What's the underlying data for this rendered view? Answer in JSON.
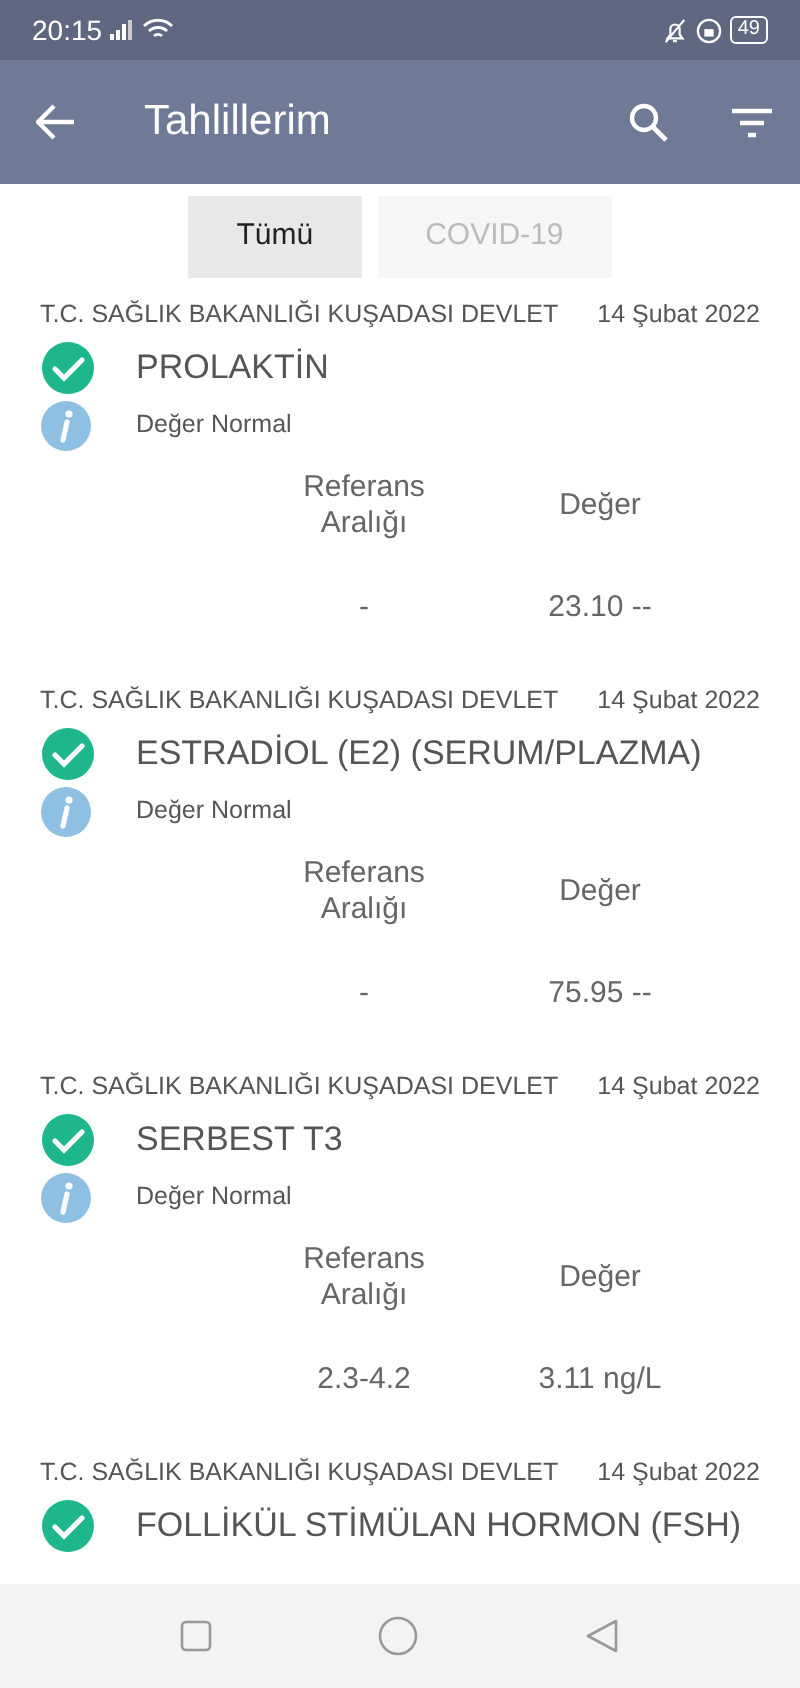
{
  "status_bar": {
    "time": "20:15",
    "battery": "49"
  },
  "app_bar": {
    "title": "Tahlillerim"
  },
  "tabs": [
    {
      "label": "Tümü",
      "selected": true
    },
    {
      "label": "COVID-19",
      "selected": false
    }
  ],
  "results": [
    {
      "hospital": "T.C. SAĞLIK BAKANLIĞI KUŞADASI DEVLET",
      "date": "14 Şubat 2022",
      "test": "PROLAKTİN",
      "note": "Değer Normal",
      "range_header": "Referans Aralığı",
      "value_header": "Değer",
      "range": "-",
      "value": "23.10 --"
    },
    {
      "hospital": "T.C. SAĞLIK BAKANLIĞI KUŞADASI DEVLET",
      "date": "14 Şubat 2022",
      "test": "ESTRADİOL (E2) (SERUM/PLAZMA)",
      "note": "Değer Normal",
      "range_header": "Referans Aralığı",
      "value_header": "Değer",
      "range": "-",
      "value": "75.95 --"
    },
    {
      "hospital": "T.C. SAĞLIK BAKANLIĞI KUŞADASI DEVLET",
      "date": "14 Şubat 2022",
      "test": "SERBEST T3",
      "note": "Değer Normal",
      "range_header": "Referans Aralığı",
      "value_header": "Değer",
      "range": "2.3-4.2",
      "value": "3.11 ng/L"
    },
    {
      "hospital": "T.C. SAĞLIK BAKANLIĞI KUŞADASI DEVLET",
      "date": "14 Şubat 2022",
      "test": "FOLLİKÜL STİMÜLAN HORMON (FSH)"
    }
  ]
}
